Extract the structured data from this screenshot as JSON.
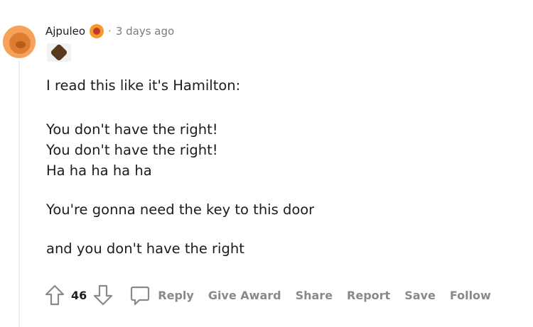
{
  "comment": {
    "username": "Ajpuleo",
    "separator": "·",
    "timestamp": "3 days ago",
    "lines": [
      "I read this like it's Hamilton:",
      "You don't have the right!",
      "You don't have the right!",
      "Ha ha ha ha ha",
      "You're gonna need the key to this door",
      "and you don't have the right"
    ],
    "vote_count": "46"
  },
  "actions": {
    "reply": "Reply",
    "give_award": "Give Award",
    "share": "Share",
    "report": "Report",
    "save": "Save",
    "follow": "Follow"
  },
  "colors": {
    "text": "#1c1c1c",
    "meta": "#7c7c7c",
    "action": "#878a8c",
    "thread_line": "#edeff1"
  },
  "icons": [
    "avatar",
    "flair-icon",
    "award-icon",
    "upvote-icon",
    "downvote-icon",
    "comment-icon"
  ]
}
